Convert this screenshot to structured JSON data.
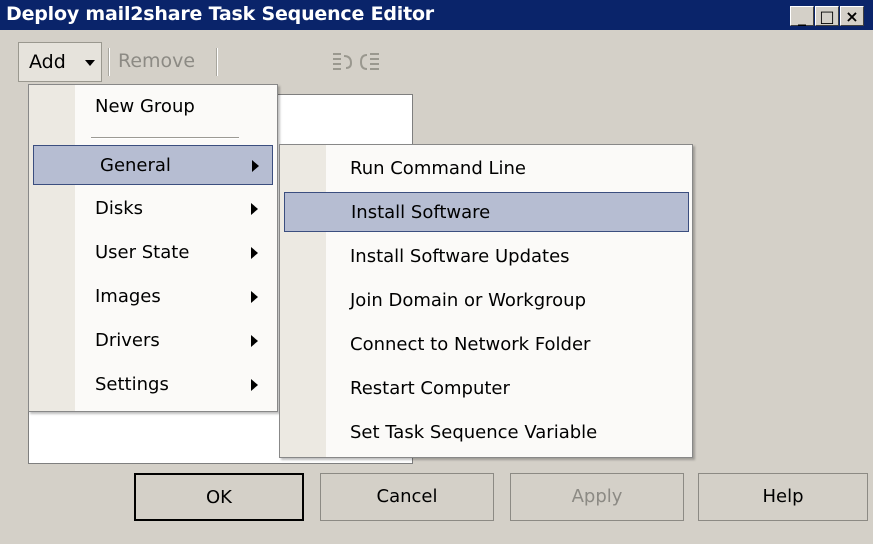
{
  "window": {
    "title": "Deploy mail2share Task Sequence Editor",
    "controls": {
      "minimize": "_",
      "maximize": "□",
      "close": "×"
    }
  },
  "toolbar": {
    "add_label": "Add",
    "remove_label": "Remove",
    "icons": [
      "move-up-icon",
      "move-down-icon"
    ]
  },
  "add_menu": {
    "items": [
      {
        "label": "New Group",
        "has_submenu": false
      },
      {
        "label": "General",
        "has_submenu": true,
        "selected": true
      },
      {
        "label": "Disks",
        "has_submenu": true
      },
      {
        "label": "User State",
        "has_submenu": true
      },
      {
        "label": "Images",
        "has_submenu": true
      },
      {
        "label": "Drivers",
        "has_submenu": true
      },
      {
        "label": "Settings",
        "has_submenu": true
      }
    ]
  },
  "general_submenu": {
    "items": [
      {
        "label": "Run Command Line"
      },
      {
        "label": "Install Software",
        "selected": true
      },
      {
        "label": "Install Software Updates"
      },
      {
        "label": "Join Domain or Workgroup"
      },
      {
        "label": "Connect to Network Folder"
      },
      {
        "label": "Restart Computer"
      },
      {
        "label": "Set Task Sequence Variable"
      }
    ]
  },
  "buttons": {
    "ok": "OK",
    "cancel": "Cancel",
    "apply": "Apply",
    "help": "Help"
  },
  "colors": {
    "titlebar": "#0a246a",
    "selection": "#b6bdd2",
    "window_face": "#d4d0c8"
  }
}
